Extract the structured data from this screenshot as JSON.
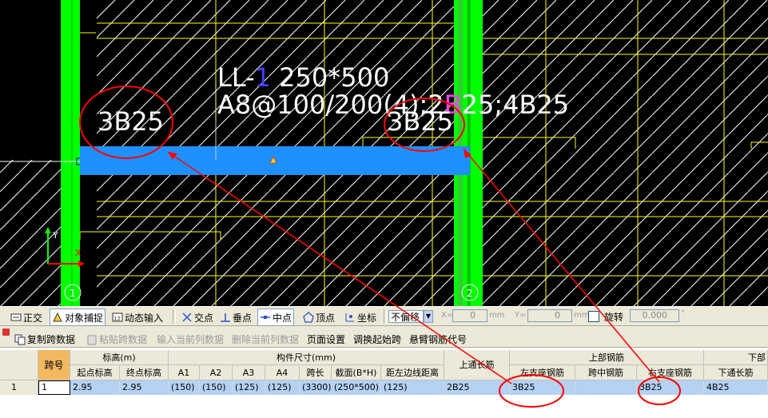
{
  "drawing": {
    "beam_label_line1": "LL-",
    "beam_label_num": "1",
    "beam_label_size": " 250*500",
    "beam_label_line2a": "A8@100/200(4)",
    "beam_label_line2b": ";2",
    "beam_label_line2c": "B",
    "beam_label_line2d": "25;4B25",
    "left_support_label": "3B25",
    "right_support_label": "3B25",
    "axis_left": "1",
    "axis_right": "2",
    "axis_y": "Y",
    "axis_x": "X"
  },
  "toolbar1": {
    "ortho": "正交",
    "snap": "对象捕捉",
    "dynamic_input": "动态输入",
    "intersection": "交点",
    "perpendicular": "垂点",
    "midpoint": "中点",
    "vertex": "顶点",
    "coordinate": "坐标",
    "offset_select": "不偏移",
    "x_label": "X=",
    "x_value": "0",
    "y_label": "Y=",
    "y_value": "0",
    "unit": "mm",
    "rotate_label": "旋转",
    "rotate_value": "0.000",
    "degree": "°"
  },
  "toolbar2": {
    "copy_span": "复制跨数据",
    "paste_span": "粘贴跨数据",
    "input_current_col": "输入当前列数据",
    "delete_current_col": "删除当前列数据",
    "page_setup": "页面设置",
    "swap_start_span": "调换起始跨",
    "cantilever_code": "悬臂钢筋代号"
  },
  "grid": {
    "headers": {
      "span_no": "跨号",
      "elevation": "标高(m)",
      "start_elev": "起点标高",
      "end_elev": "终点标高",
      "dims": "构件尺寸(mm)",
      "a1": "A1",
      "a2": "A2",
      "a3": "A3",
      "a4": "A4",
      "span_len": "跨长",
      "section": "截面(B*H)",
      "dist_left": "距左边线距离",
      "top_through": "上通长筋",
      "top_rebar": "上部钢筋",
      "left_support": "左支座钢筋",
      "mid_span": "跨中钢筋",
      "right_support": "右支座钢筋",
      "bottom_rebar": "下部",
      "bottom_through": "下通长筋"
    },
    "row": {
      "index": "1",
      "span_no": "1",
      "start_elev": "2.95",
      "end_elev": "2.95",
      "a1": "(150)",
      "a2": "(150)",
      "a3": "(125)",
      "a4": "(125)",
      "span_len": "(3300)",
      "section": "(250*500)",
      "dist_left": "(125)",
      "top_through": "2B25",
      "left_support": "3B25",
      "mid_span": "",
      "right_support": "3B25",
      "bottom_through": "4B25"
    }
  }
}
